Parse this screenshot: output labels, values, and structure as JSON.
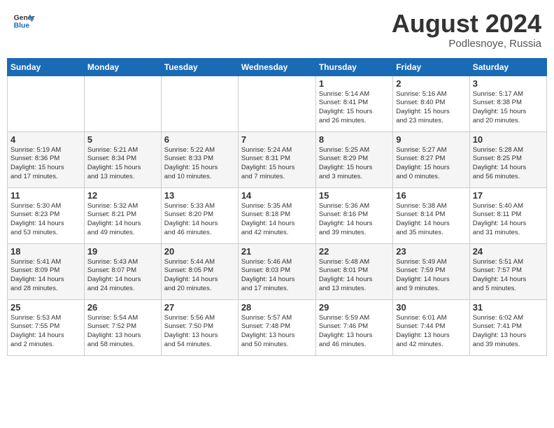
{
  "header": {
    "logo_line1": "General",
    "logo_line2": "Blue",
    "month": "August 2024",
    "location": "Podlesnoye, Russia"
  },
  "days_of_week": [
    "Sunday",
    "Monday",
    "Tuesday",
    "Wednesday",
    "Thursday",
    "Friday",
    "Saturday"
  ],
  "weeks": [
    [
      {
        "day": "",
        "info": ""
      },
      {
        "day": "",
        "info": ""
      },
      {
        "day": "",
        "info": ""
      },
      {
        "day": "",
        "info": ""
      },
      {
        "day": "1",
        "info": "Sunrise: 5:14 AM\nSunset: 8:41 PM\nDaylight: 15 hours\nand 26 minutes."
      },
      {
        "day": "2",
        "info": "Sunrise: 5:16 AM\nSunset: 8:40 PM\nDaylight: 15 hours\nand 23 minutes."
      },
      {
        "day": "3",
        "info": "Sunrise: 5:17 AM\nSunset: 8:38 PM\nDaylight: 15 hours\nand 20 minutes."
      }
    ],
    [
      {
        "day": "4",
        "info": "Sunrise: 5:19 AM\nSunset: 8:36 PM\nDaylight: 15 hours\nand 17 minutes."
      },
      {
        "day": "5",
        "info": "Sunrise: 5:21 AM\nSunset: 8:34 PM\nDaylight: 15 hours\nand 13 minutes."
      },
      {
        "day": "6",
        "info": "Sunrise: 5:22 AM\nSunset: 8:33 PM\nDaylight: 15 hours\nand 10 minutes."
      },
      {
        "day": "7",
        "info": "Sunrise: 5:24 AM\nSunset: 8:31 PM\nDaylight: 15 hours\nand 7 minutes."
      },
      {
        "day": "8",
        "info": "Sunrise: 5:25 AM\nSunset: 8:29 PM\nDaylight: 15 hours\nand 3 minutes."
      },
      {
        "day": "9",
        "info": "Sunrise: 5:27 AM\nSunset: 8:27 PM\nDaylight: 15 hours\nand 0 minutes."
      },
      {
        "day": "10",
        "info": "Sunrise: 5:28 AM\nSunset: 8:25 PM\nDaylight: 14 hours\nand 56 minutes."
      }
    ],
    [
      {
        "day": "11",
        "info": "Sunrise: 5:30 AM\nSunset: 8:23 PM\nDaylight: 14 hours\nand 53 minutes."
      },
      {
        "day": "12",
        "info": "Sunrise: 5:32 AM\nSunset: 8:21 PM\nDaylight: 14 hours\nand 49 minutes."
      },
      {
        "day": "13",
        "info": "Sunrise: 5:33 AM\nSunset: 8:20 PM\nDaylight: 14 hours\nand 46 minutes."
      },
      {
        "day": "14",
        "info": "Sunrise: 5:35 AM\nSunset: 8:18 PM\nDaylight: 14 hours\nand 42 minutes."
      },
      {
        "day": "15",
        "info": "Sunrise: 5:36 AM\nSunset: 8:16 PM\nDaylight: 14 hours\nand 39 minutes."
      },
      {
        "day": "16",
        "info": "Sunrise: 5:38 AM\nSunset: 8:14 PM\nDaylight: 14 hours\nand 35 minutes."
      },
      {
        "day": "17",
        "info": "Sunrise: 5:40 AM\nSunset: 8:11 PM\nDaylight: 14 hours\nand 31 minutes."
      }
    ],
    [
      {
        "day": "18",
        "info": "Sunrise: 5:41 AM\nSunset: 8:09 PM\nDaylight: 14 hours\nand 28 minutes."
      },
      {
        "day": "19",
        "info": "Sunrise: 5:43 AM\nSunset: 8:07 PM\nDaylight: 14 hours\nand 24 minutes."
      },
      {
        "day": "20",
        "info": "Sunrise: 5:44 AM\nSunset: 8:05 PM\nDaylight: 14 hours\nand 20 minutes."
      },
      {
        "day": "21",
        "info": "Sunrise: 5:46 AM\nSunset: 8:03 PM\nDaylight: 14 hours\nand 17 minutes."
      },
      {
        "day": "22",
        "info": "Sunrise: 5:48 AM\nSunset: 8:01 PM\nDaylight: 14 hours\nand 13 minutes."
      },
      {
        "day": "23",
        "info": "Sunrise: 5:49 AM\nSunset: 7:59 PM\nDaylight: 14 hours\nand 9 minutes."
      },
      {
        "day": "24",
        "info": "Sunrise: 5:51 AM\nSunset: 7:57 PM\nDaylight: 14 hours\nand 5 minutes."
      }
    ],
    [
      {
        "day": "25",
        "info": "Sunrise: 5:53 AM\nSunset: 7:55 PM\nDaylight: 14 hours\nand 2 minutes."
      },
      {
        "day": "26",
        "info": "Sunrise: 5:54 AM\nSunset: 7:52 PM\nDaylight: 13 hours\nand 58 minutes."
      },
      {
        "day": "27",
        "info": "Sunrise: 5:56 AM\nSunset: 7:50 PM\nDaylight: 13 hours\nand 54 minutes."
      },
      {
        "day": "28",
        "info": "Sunrise: 5:57 AM\nSunset: 7:48 PM\nDaylight: 13 hours\nand 50 minutes."
      },
      {
        "day": "29",
        "info": "Sunrise: 5:59 AM\nSunset: 7:46 PM\nDaylight: 13 hours\nand 46 minutes."
      },
      {
        "day": "30",
        "info": "Sunrise: 6:01 AM\nSunset: 7:44 PM\nDaylight: 13 hours\nand 42 minutes."
      },
      {
        "day": "31",
        "info": "Sunrise: 6:02 AM\nSunset: 7:41 PM\nDaylight: 13 hours\nand 39 minutes."
      }
    ]
  ]
}
